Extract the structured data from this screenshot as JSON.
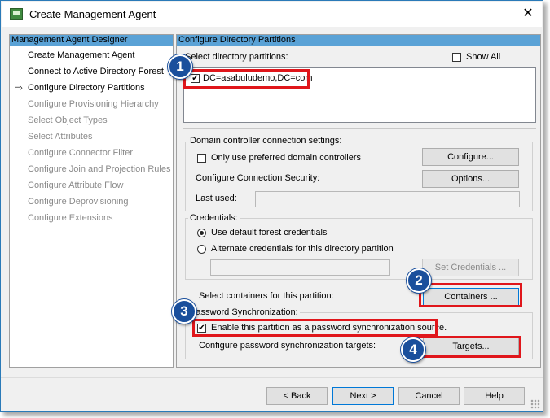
{
  "window": {
    "title": "Create Management Agent",
    "close_glyph": "✕"
  },
  "left_pane": {
    "header": "Management Agent Designer",
    "current_marker": "⇨",
    "items": [
      {
        "label": "Create Management Agent",
        "enabled": true
      },
      {
        "label": "Connect to Active Directory Forest",
        "enabled": true
      },
      {
        "label": "Configure Directory Partitions",
        "enabled": true,
        "current": true
      },
      {
        "label": "Configure Provisioning Hierarchy",
        "enabled": false
      },
      {
        "label": "Select Object Types",
        "enabled": false
      },
      {
        "label": "Select Attributes",
        "enabled": false
      },
      {
        "label": "Configure Connector Filter",
        "enabled": false
      },
      {
        "label": "Configure Join and Projection Rules",
        "enabled": false
      },
      {
        "label": "Configure Attribute Flow",
        "enabled": false
      },
      {
        "label": "Configure Deprovisioning",
        "enabled": false
      },
      {
        "label": "Configure Extensions",
        "enabled": false
      }
    ]
  },
  "right_pane": {
    "header": "Configure Directory Partitions",
    "select_partitions_label": "Select directory partitions:",
    "show_all": {
      "label": "Show All",
      "checked": false
    },
    "partitions": [
      {
        "label": "DC=asabuludemo,DC=com",
        "checked": true
      }
    ],
    "dc_group": {
      "title": "Domain controller connection settings:",
      "only_preferred": {
        "label": "Only use preferred domain controllers",
        "checked": false
      },
      "configure_button": "Configure...",
      "security_label": "Configure Connection Security:",
      "options_button": "Options...",
      "last_used_label": "Last used:",
      "last_used_value": ""
    },
    "credentials_group": {
      "title": "Credentials:",
      "default_option": {
        "label": "Use default forest credentials",
        "selected": true
      },
      "alternate_option": {
        "label": "Alternate credentials for this directory partition",
        "selected": false
      },
      "alternate_value": "",
      "set_credentials_button": "Set Credentials ..."
    },
    "containers_label": "Select containers for this partition:",
    "containers_button": "Containers ...",
    "password_group": {
      "title": "Password Synchronization:",
      "enable": {
        "label": "Enable this partition as a password synchronization source.",
        "checked": true
      },
      "targets_label": "Configure password synchronization targets:",
      "targets_button": "Targets..."
    }
  },
  "footer": {
    "back_button": "< Back",
    "next_button": "Next >",
    "cancel_button": "Cancel",
    "help_button": "Help"
  },
  "callouts": [
    "1",
    "2",
    "3",
    "4"
  ],
  "colors": {
    "accent_header": "#5aa2d6",
    "callout_box": "#e0161b",
    "callout_badge": "#1a4f9c",
    "window_border": "#2a7ab8"
  },
  "check_glyph": "✔"
}
